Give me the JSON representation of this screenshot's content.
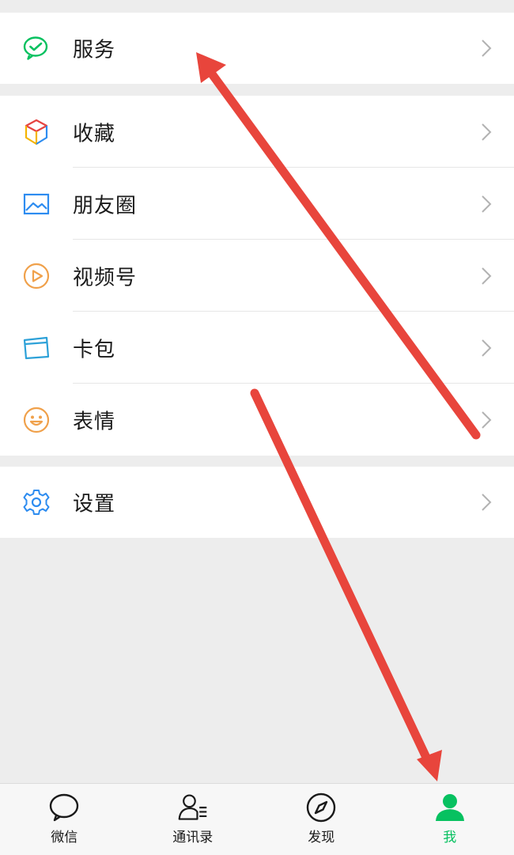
{
  "menu": {
    "service": {
      "label": "服务",
      "icon": "wechat-pay-icon"
    },
    "items": [
      {
        "label": "收藏",
        "icon": "favorites-cube-icon"
      },
      {
        "label": "朋友圈",
        "icon": "moments-image-icon"
      },
      {
        "label": "视频号",
        "icon": "channels-play-icon"
      },
      {
        "label": "卡包",
        "icon": "card-wallet-icon"
      },
      {
        "label": "表情",
        "icon": "smiley-icon"
      }
    ],
    "settings": {
      "label": "设置",
      "icon": "gear-icon"
    }
  },
  "tabbar": {
    "tabs": [
      {
        "label": "微信",
        "icon": "chat-bubble-icon",
        "active": false
      },
      {
        "label": "通讯录",
        "icon": "contacts-icon",
        "active": false
      },
      {
        "label": "发现",
        "icon": "compass-icon",
        "active": false
      },
      {
        "label": "我",
        "icon": "person-icon",
        "active": true
      }
    ]
  },
  "colors": {
    "accent_green": "#07c160",
    "annotation_red": "#e8453c",
    "background": "#ededed"
  }
}
